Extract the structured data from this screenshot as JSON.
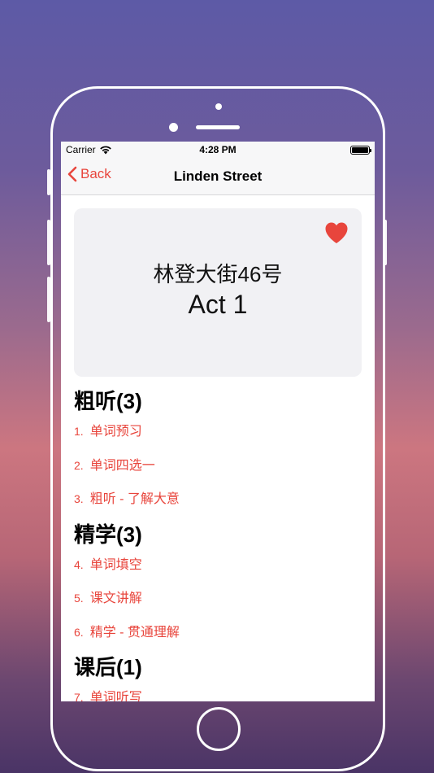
{
  "status_bar": {
    "carrier": "Carrier",
    "time": "4:28 PM"
  },
  "nav": {
    "back_label": "Back",
    "title": "Linden Street"
  },
  "hero": {
    "title_cn": "林登大街46号",
    "title_en": "Act 1",
    "favorited": true
  },
  "sections": [
    {
      "title": "粗听(3)",
      "items": [
        {
          "num": "1.",
          "label": "单词预习"
        },
        {
          "num": "2.",
          "label": "单词四选一"
        },
        {
          "num": "3.",
          "label": "粗听 - 了解大意"
        }
      ]
    },
    {
      "title": "精学(3)",
      "items": [
        {
          "num": "4.",
          "label": "单词填空"
        },
        {
          "num": "5.",
          "label": "课文讲解"
        },
        {
          "num": "6.",
          "label": "精学 - 贯通理解"
        }
      ]
    },
    {
      "title": "课后(1)",
      "items": [
        {
          "num": "7.",
          "label": "单词听写"
        }
      ]
    }
  ],
  "colors": {
    "accent": "#e8453c",
    "card_bg": "#f1f1f4"
  }
}
